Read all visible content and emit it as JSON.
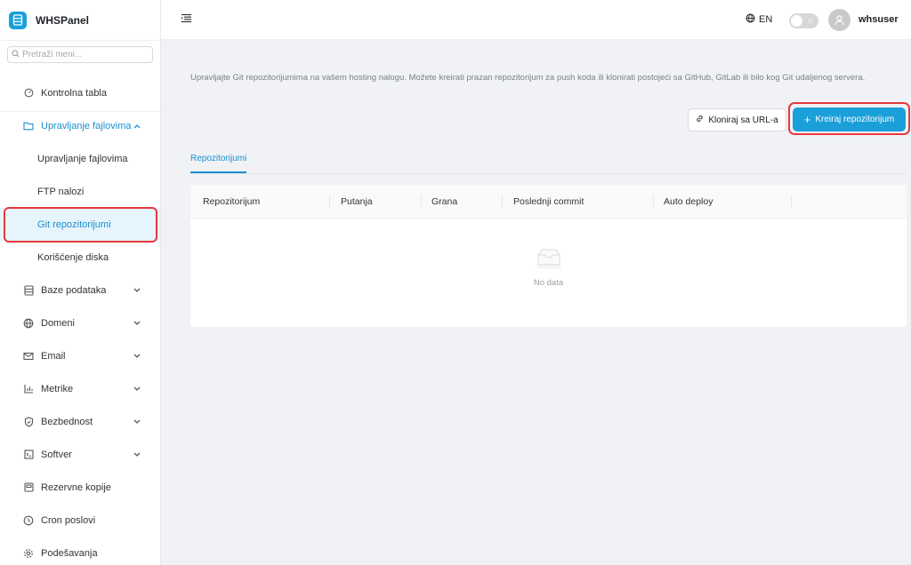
{
  "brand": {
    "name": "WHSPanel",
    "color": "#1a9fd9"
  },
  "search": {
    "placeholder": "Pretraži meni..."
  },
  "sidebar": {
    "items": [
      {
        "label": "Kontrolna tabla",
        "icon": "dashboard-icon"
      },
      {
        "label": "Upravljanje fajlovima",
        "icon": "folder-icon",
        "expanded": true,
        "children": [
          {
            "label": "Upravljanje fajlovima"
          },
          {
            "label": "FTP nalozi"
          },
          {
            "label": "Git repozitorijumi",
            "active": true
          },
          {
            "label": "Korišćenje diska"
          }
        ]
      },
      {
        "label": "Baze podataka",
        "icon": "database-icon"
      },
      {
        "label": "Domeni",
        "icon": "globe-icon"
      },
      {
        "label": "Email",
        "icon": "mail-icon"
      },
      {
        "label": "Metrike",
        "icon": "chart-icon"
      },
      {
        "label": "Bezbednost",
        "icon": "shield-icon"
      },
      {
        "label": "Softver",
        "icon": "terminal-icon"
      },
      {
        "label": "Rezervne kopije",
        "icon": "backup-icon"
      },
      {
        "label": "Cron poslovi",
        "icon": "clock-icon"
      },
      {
        "label": "Podešavanja",
        "icon": "gear-icon"
      }
    ]
  },
  "header": {
    "language": "EN",
    "username": "whsuser"
  },
  "main": {
    "description": "Upravljajte Git repozitorijumima na vašem hosting nalogu. Možete kreirati prazan repozitorijum za push koda ili klonirati postojeći sa GitHub, GitLab ili bilo kog Git udaljenog servera.",
    "clone_label": "Kloniraj sa URL-a",
    "create_label": "Kreiraj repozitorijum",
    "tab_label": "Repozitorijumi",
    "columns": [
      "Repozitorijum",
      "Putanja",
      "Grana",
      "Poslednji commit",
      "Auto deploy"
    ],
    "empty_text": "No data"
  },
  "colors": {
    "accent": "#1a9fd9",
    "highlight": "#e8383d"
  }
}
